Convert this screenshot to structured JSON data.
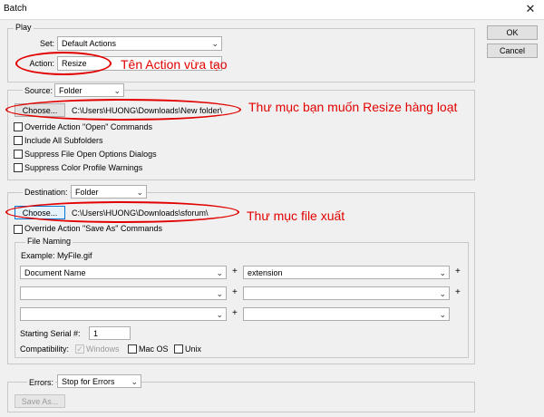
{
  "window": {
    "title": "Batch",
    "close_glyph": "✕"
  },
  "buttons": {
    "ok": "OK",
    "cancel": "Cancel",
    "choose": "Choose...",
    "save_as": "Save As..."
  },
  "play": {
    "group_label": "Play",
    "set_label": "Set:",
    "set_value": "Default Actions",
    "action_label": "Action:",
    "action_value": "Resize"
  },
  "source": {
    "label": "Source:",
    "value": "Folder",
    "path": "C:\\Users\\HUONG\\Downloads\\New folder\\",
    "options": [
      "Override Action \"Open\" Commands",
      "Include All Subfolders",
      "Suppress File Open Options Dialogs",
      "Suppress Color Profile Warnings"
    ]
  },
  "destination": {
    "label": "Destination:",
    "value": "Folder",
    "path": "C:\\Users\\HUONG\\Downloads\\sforum\\",
    "override_label": "Override Action \"Save As\" Commands"
  },
  "file_naming": {
    "group_label": "File Naming",
    "example": "Example: MyFile.gif",
    "fields": [
      [
        "Document Name",
        "extension"
      ],
      [
        "",
        ""
      ],
      [
        "",
        ""
      ]
    ],
    "plus": "+",
    "serial_label": "Starting Serial #:",
    "serial_value": "1",
    "compat_label": "Compatibility:",
    "compat_windows": "Windows",
    "compat_macos": "Mac OS",
    "compat_unix": "Unix",
    "windows_checked_glyph": "✓"
  },
  "errors": {
    "label": "Errors:",
    "value": "Stop for Errors"
  },
  "annotations": {
    "action": "Tên Action vừa tạo",
    "source": "Thư mục bạn muốn Resize hàng loạt",
    "destination": "Thư mục file xuất"
  },
  "colors": {
    "annotation": "#e20000",
    "focus_border": "#0078d7"
  },
  "icons": {
    "dropdown": "chevron-down-icon",
    "close": "close-icon"
  }
}
